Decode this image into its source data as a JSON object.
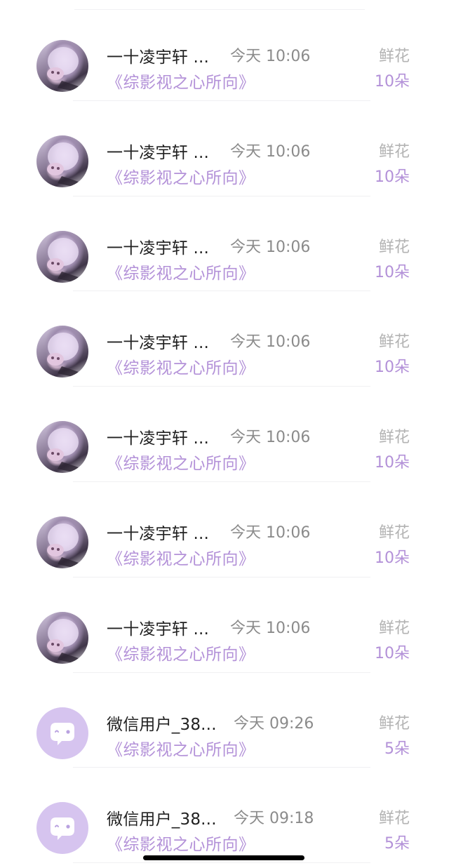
{
  "rows": [
    {
      "avatar": "photo-avatar",
      "name": "一十凌宇轩 ...",
      "time": "今天 10:06",
      "book": "《综影视之心所向》",
      "gift_label": "鲜花",
      "gift_count": "10朵"
    },
    {
      "avatar": "photo-avatar",
      "name": "一十凌宇轩 ...",
      "time": "今天 10:06",
      "book": "《综影视之心所向》",
      "gift_label": "鲜花",
      "gift_count": "10朵"
    },
    {
      "avatar": "photo-avatar",
      "name": "一十凌宇轩 ...",
      "time": "今天 10:06",
      "book": "《综影视之心所向》",
      "gift_label": "鲜花",
      "gift_count": "10朵"
    },
    {
      "avatar": "photo-avatar",
      "name": "一十凌宇轩 ...",
      "time": "今天 10:06",
      "book": "《综影视之心所向》",
      "gift_label": "鲜花",
      "gift_count": "10朵"
    },
    {
      "avatar": "photo-avatar",
      "name": "一十凌宇轩 ...",
      "time": "今天 10:06",
      "book": "《综影视之心所向》",
      "gift_label": "鲜花",
      "gift_count": "10朵"
    },
    {
      "avatar": "photo-avatar",
      "name": "一十凌宇轩 ...",
      "time": "今天 10:06",
      "book": "《综影视之心所向》",
      "gift_label": "鲜花",
      "gift_count": "10朵"
    },
    {
      "avatar": "photo-avatar",
      "name": "一十凌宇轩 ...",
      "time": "今天 10:06",
      "book": "《综影视之心所向》",
      "gift_label": "鲜花",
      "gift_count": "10朵"
    },
    {
      "avatar": "wechat-default-avatar",
      "name": "微信用户_38...",
      "time": "今天 09:26",
      "book": "《综影视之心所向》",
      "gift_label": "鲜花",
      "gift_count": "5朵"
    },
    {
      "avatar": "wechat-default-avatar",
      "name": "微信用户_38...",
      "time": "今天 09:18",
      "book": "《综影视之心所向》",
      "gift_label": "鲜花",
      "gift_count": "5朵"
    }
  ],
  "colors": {
    "accent": "#b391d8",
    "avatar_bg": "#d6c4ef",
    "name": "#222222",
    "muted": "#8b8b8b",
    "label": "#b3b3b3"
  }
}
